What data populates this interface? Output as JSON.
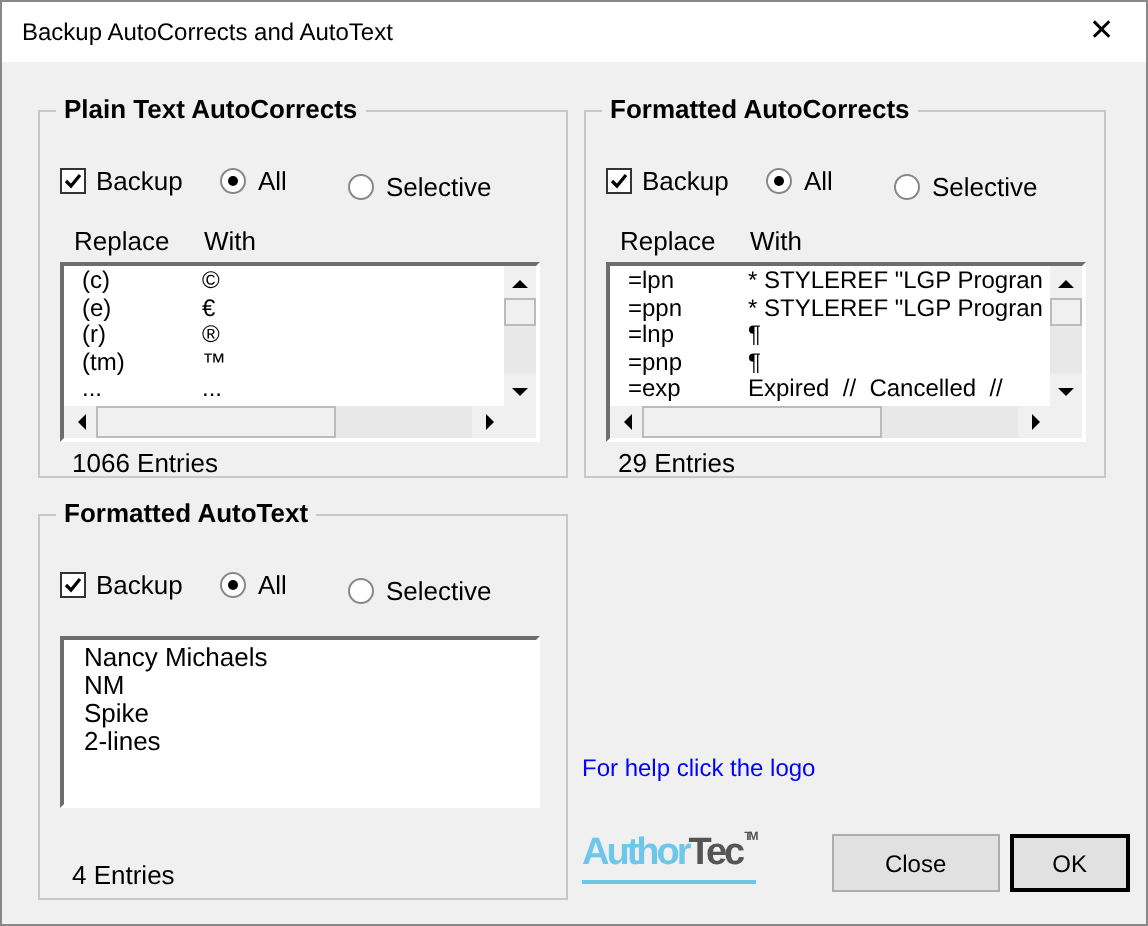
{
  "window": {
    "title": "Backup AutoCorrects and AutoText",
    "close": "✕"
  },
  "groups": [
    {
      "kind": "table",
      "title": "Plain Text AutoCorrects",
      "backup": {
        "label": "Backup",
        "checked": true
      },
      "options": [
        {
          "label": "All",
          "selected": true
        },
        {
          "label": "Selective",
          "selected": false
        }
      ],
      "columns": [
        "Replace",
        "With"
      ],
      "rows": [
        [
          "(c)",
          "©"
        ],
        [
          "(e)",
          "€"
        ],
        [
          "(r)",
          "®"
        ],
        [
          "(tm)",
          "™"
        ],
        [
          "...",
          "..."
        ]
      ],
      "count": "1066 Entries"
    },
    {
      "kind": "table",
      "title": "Formatted AutoCorrects",
      "backup": {
        "label": "Backup",
        "checked": true
      },
      "options": [
        {
          "label": "All",
          "selected": true
        },
        {
          "label": "Selective",
          "selected": false
        }
      ],
      "columns": [
        "Replace",
        "With"
      ],
      "rows": [
        [
          "=lpn",
          "* STYLEREF \"LGP Progran"
        ],
        [
          "=ppn",
          "* STYLEREF \"LGP Progran"
        ],
        [
          "=lnp",
          "¶"
        ],
        [
          "=pnp",
          "¶"
        ],
        [
          "=exp",
          "Expired  //  Cancelled  //"
        ]
      ],
      "count": "29 Entries"
    },
    {
      "kind": "list",
      "title": "Formatted AutoText",
      "backup": {
        "label": "Backup",
        "checked": true
      },
      "options": [
        {
          "label": "All",
          "selected": true
        },
        {
          "label": "Selective",
          "selected": false
        }
      ],
      "items": [
        "Nancy Michaels",
        "NM",
        "Spike",
        "2-lines"
      ],
      "count": "4 Entries"
    }
  ],
  "help_link": "For help click the logo",
  "logo": {
    "part_1": "Author",
    "part_2": "Tec",
    "mark": "TM"
  },
  "buttons": [
    {
      "label": "Close",
      "default": false
    },
    {
      "label": "OK",
      "default": true
    }
  ]
}
